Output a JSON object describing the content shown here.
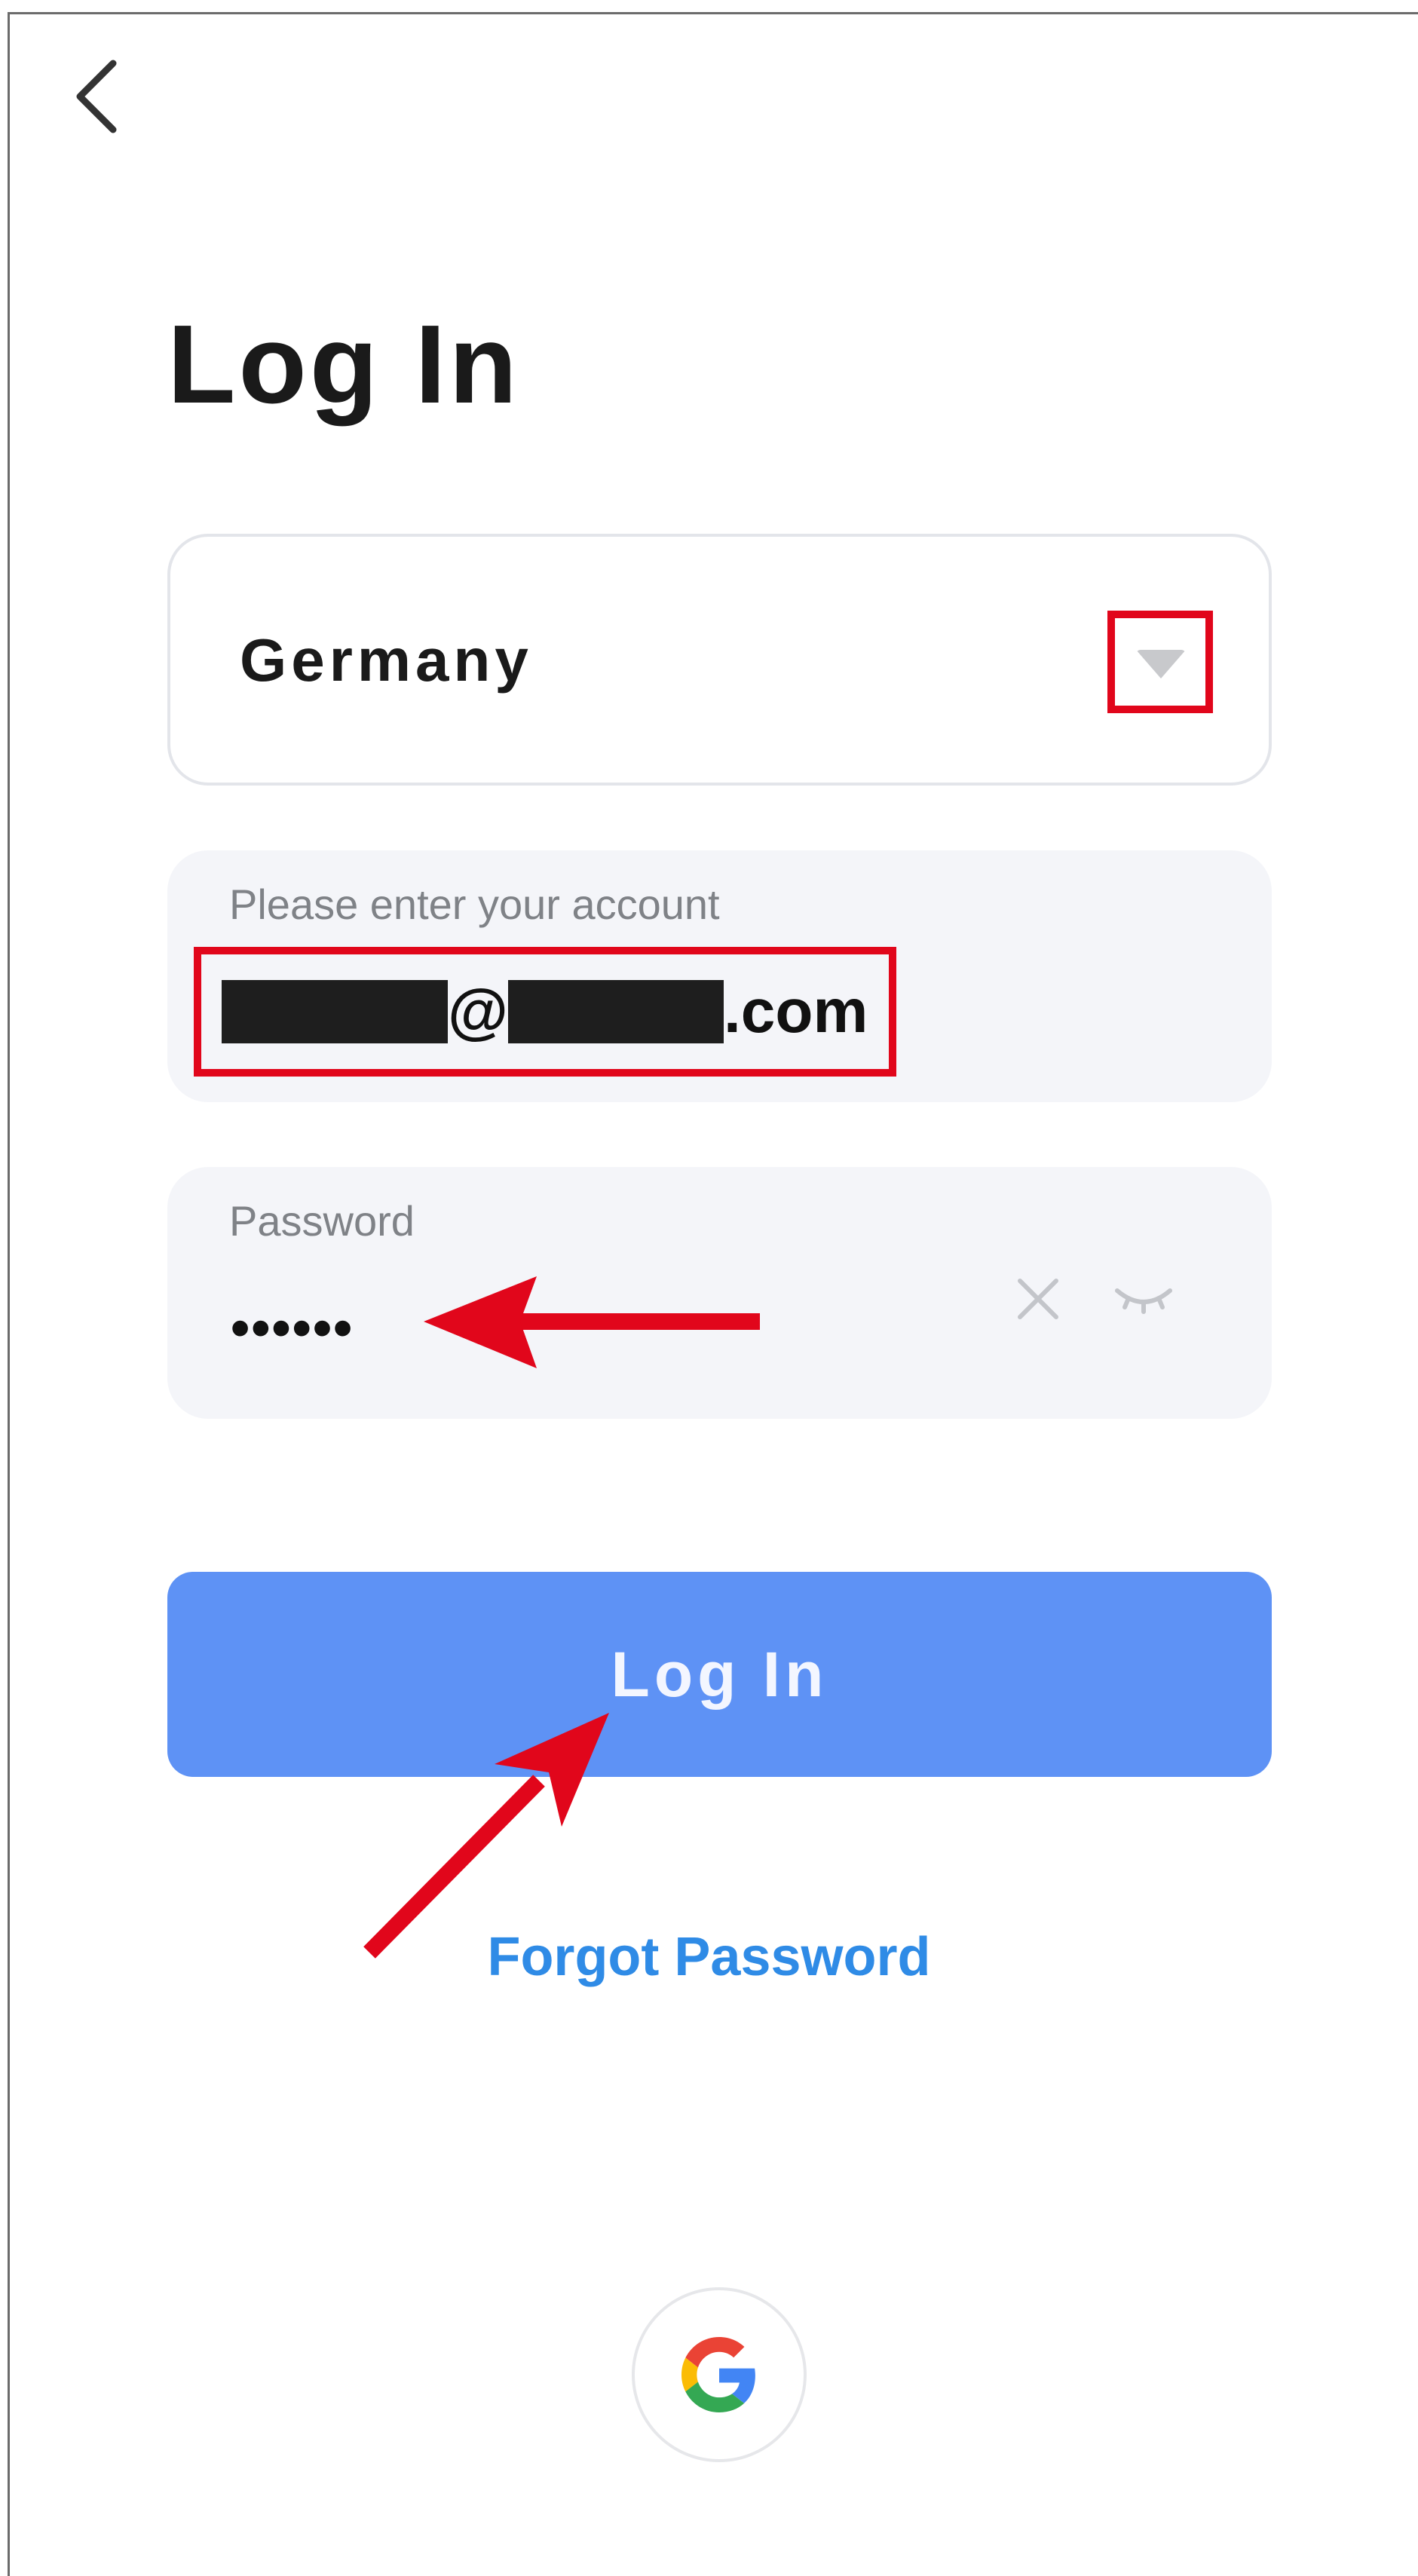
{
  "header": {
    "back_icon": "chevron-left-icon",
    "title": "Log In"
  },
  "country_selector": {
    "value": "Germany",
    "dropdown_icon": "caret-down-icon"
  },
  "account_field": {
    "label": "Please enter your account",
    "value_at": "@",
    "value_suffix": ".com"
  },
  "password_field": {
    "label": "Password",
    "value": "••••••",
    "clear_icon": "close-icon",
    "toggle_icon": "eye-closed-icon"
  },
  "login_button": {
    "label": "Log In"
  },
  "forgot_password": {
    "label": "Forgot Password"
  },
  "social_login": {
    "google_icon": "google-icon"
  },
  "colors": {
    "accent": "#5e92f5",
    "link": "#2f8be6",
    "annotation": "#e1061b",
    "field_background": "#f4f5f9"
  }
}
